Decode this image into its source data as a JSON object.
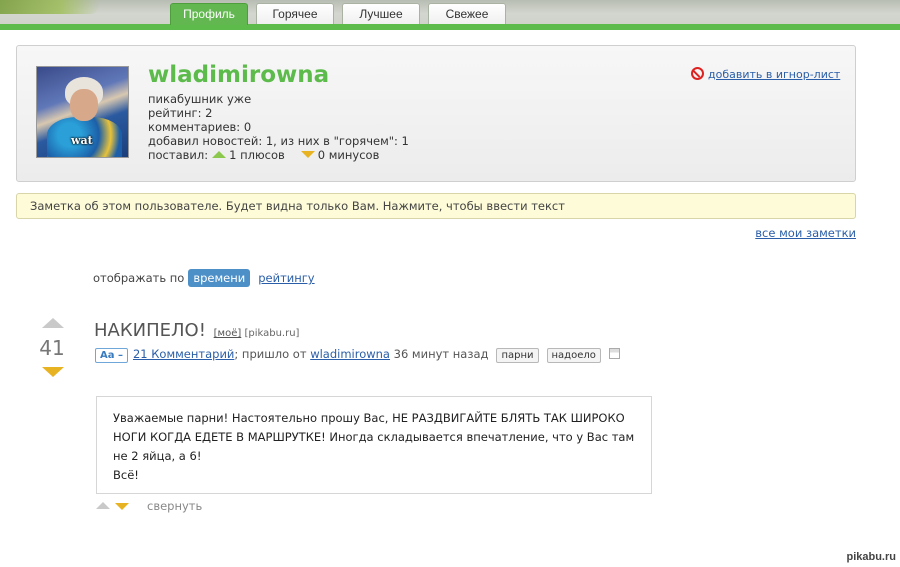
{
  "tabs": [
    {
      "label": "Профиль",
      "active": true
    },
    {
      "label": "Горячее",
      "active": false
    },
    {
      "label": "Лучшее",
      "active": false
    },
    {
      "label": "Свежее",
      "active": false
    }
  ],
  "profile": {
    "username": "wladimirowna",
    "avatar_caption": "wat",
    "line_member": "пикабушник уже",
    "line_rating": "рейтинг: 2",
    "line_comments": "комментариев: 0",
    "line_news": "добавил новостей: 1, из них в \"горячем\": 1",
    "voted_label": "поставил:",
    "plus_text": "1 плюсов",
    "minus_text": "0 минусов",
    "ignore_link": "добавить в игнор-лист"
  },
  "note": {
    "placeholder": "Заметка об этом пользователе. Будет видна только Вам. Нажмите, чтобы ввести текст",
    "all_notes_link": "все мои заметки"
  },
  "sort": {
    "label": "отображать по",
    "active": "времени",
    "other": "рейтингу"
  },
  "post": {
    "rating": "41",
    "title": "НАКИПЕЛО!",
    "mine_link": "[моё]",
    "source": "[pikabu.ru]",
    "font_toggle": "Aa –",
    "comments_link": "21 Комментарий",
    "from_text": "; пришло от",
    "author_link": "wladimirowna",
    "time_ago": "36 минут назад",
    "tags": [
      "парни",
      "надоело"
    ],
    "body_lines": [
      "Уважаемые парни! Настоятельно прошу Вас, НЕ РАЗДВИГАЙТЕ БЛЯТЬ ТАК ШИРОКО",
      "НОГИ КОГДА ЕДЕТЕ В МАРШРУТКЕ! Иногда складывается впечатление, что у Вас там",
      "не 2 яйца, а 6!",
      "Всё!"
    ],
    "collapse_label": "свернуть"
  },
  "watermark": "pikabu.ru",
  "colors": {
    "brand_green": "#5cbb4a",
    "link_blue": "#2a5ea8",
    "note_bg": "#fdfbd8",
    "downvote_yellow": "#e8b323"
  }
}
